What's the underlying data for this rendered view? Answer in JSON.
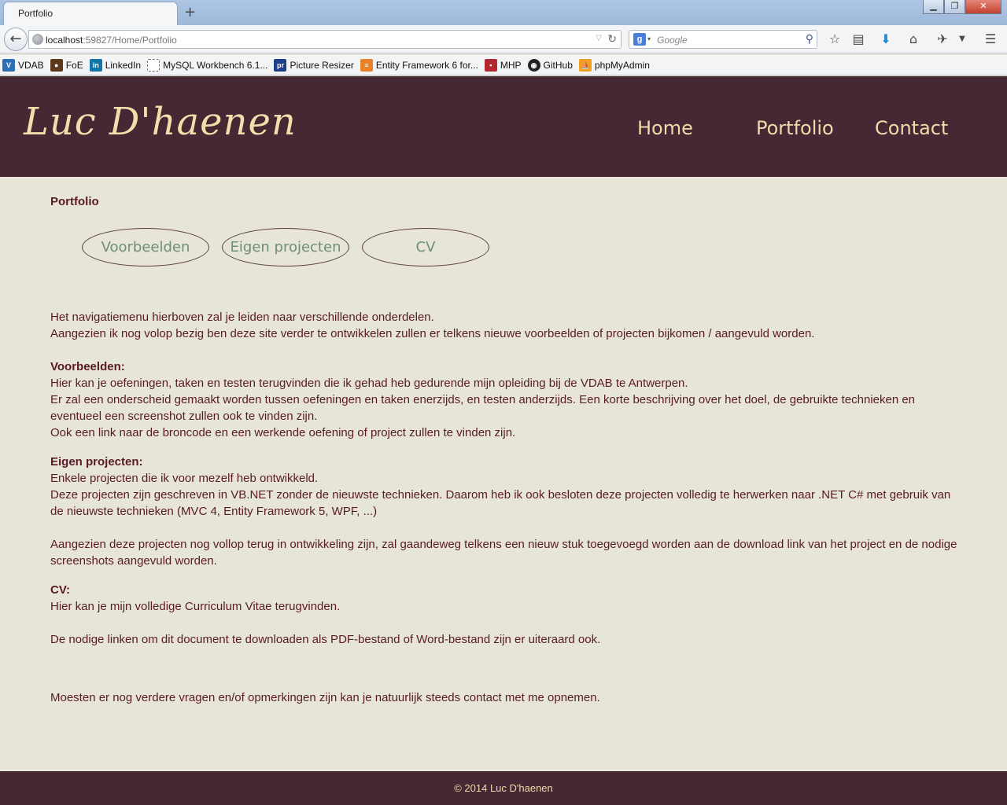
{
  "browser": {
    "tab_title": "Portfolio",
    "new_tab": "+",
    "url_host": "localhost",
    "url_rest": ":59827/Home/Portfolio",
    "search_placeholder": "Google",
    "bookmarks": [
      {
        "label": "VDAB",
        "icon": "vdab-icon",
        "color": "#2f6db5"
      },
      {
        "label": "FoE",
        "icon": "foe-icon",
        "color": "#5a3a1a"
      },
      {
        "label": "LinkedIn",
        "icon": "linkedin-icon",
        "color": "#0e76a8"
      },
      {
        "label": "MySQL Workbench 6.1...",
        "icon": "page-icon",
        "color": "#ffffff"
      },
      {
        "label": "Picture Resizer",
        "icon": "picture-resizer-icon",
        "color": "#1f3f8a"
      },
      {
        "label": "Entity Framework 6 for...",
        "icon": "stackoverflow-icon",
        "color": "#e7812c"
      },
      {
        "label": "MHP",
        "icon": "mhp-icon",
        "color": "#b3262d"
      },
      {
        "label": "GitHub",
        "icon": "github-icon",
        "color": "#222222"
      },
      {
        "label": "phpMyAdmin",
        "icon": "phpmyadmin-icon",
        "color": "#f0a020"
      }
    ]
  },
  "site": {
    "logo": "Luc D'haenen",
    "nav": [
      "Home",
      "Portfolio",
      "Contact"
    ],
    "page_title": "Portfolio",
    "pills": [
      "Voorbeelden",
      "Eigen projecten",
      "CV"
    ],
    "intro_1": "Het navigatiemenu hierboven zal je leiden naar verschillende onderdelen.",
    "intro_2": "Aangezien ik nog volop bezig ben deze site verder te ontwikkelen zullen er telkens nieuwe voorbeelden of projecten bijkomen / aangevuld worden.",
    "voorbeelden_heading": "Voorbeelden:",
    "voorbeelden_1": "Hier kan je oefeningen, taken en testen terugvinden die ik gehad heb gedurende mijn opleiding bij de VDAB te Antwerpen.",
    "voorbeelden_2": "Er zal een onderscheid gemaakt worden tussen oefeningen en taken enerzijds, en testen anderzijds. Een korte beschrijving over het doel, de gebruikte technieken en eventueel een screenshot zullen ook te vinden zijn.",
    "voorbeelden_3": "Ook een link naar de broncode en een werkende oefening of project zullen te vinden zijn.",
    "eigen_heading": "Eigen projecten:",
    "eigen_1": "Enkele projecten die ik voor mezelf heb ontwikkeld.",
    "eigen_2": "Deze projecten zijn geschreven in VB.NET zonder de nieuwste technieken. Daarom heb ik ook besloten deze projecten volledig te herwerken naar .NET C# met gebruik van de nieuwste technieken (MVC 4, Entity Framework 5, WPF, ...)",
    "eigen_3": "Aangezien deze projecten nog vollop terug in ontwikkeling zijn, zal gaandeweg telkens een nieuw stuk toegevoegd worden aan de download link van het project en de nodige screenshots aangevuld worden.",
    "cv_heading": "CV:",
    "cv_1": "Hier kan je mijn volledige Curriculum Vitae terugvinden.",
    "cv_2": "De nodige linken om dit document te downloaden als PDF-bestand of Word-bestand zijn er uiteraard ook.",
    "closing": "Moesten er nog verdere vragen en/of opmerkingen zijn kan je natuurlijk steeds contact met me opnemen.",
    "footer": "© 2014 Luc D'haenen"
  },
  "colors": {
    "header_bg": "#442834",
    "page_bg": "#e6e5d8",
    "text": "#5a1a26",
    "nav_text": "#f1d9aa",
    "pill_text": "#6f8e7a"
  }
}
